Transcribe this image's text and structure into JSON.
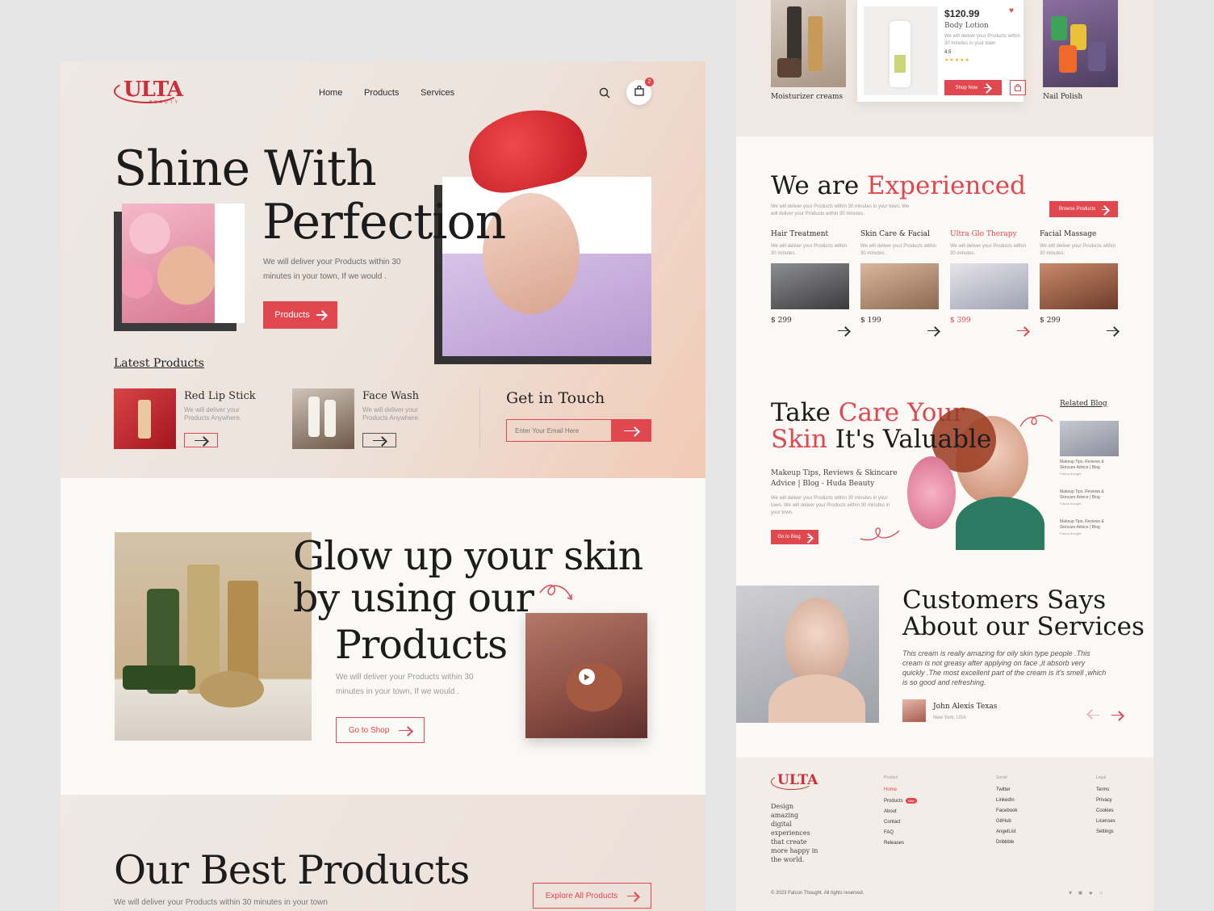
{
  "left": {
    "logo": "ULTA",
    "logo_sub": "BEAUTY",
    "nav": [
      "Home",
      "Products",
      "Services"
    ],
    "cart_count": "2",
    "hero": {
      "title_line1": "Shine With",
      "title_line2": "Perfection",
      "desc": "We will deliver your Products within 30 minutes in your town, If we would .",
      "cta": "Products"
    },
    "latest_title": "Latest Products",
    "latest": [
      {
        "name": "Red Lip Stick",
        "desc": "We will deliver your Products Anywhere."
      },
      {
        "name": "Face Wash",
        "desc": "We will deliver your Products Anywhere."
      }
    ],
    "contact": {
      "title": "Get in Touch",
      "placeholder": "Enter Your Email Here"
    },
    "glow": {
      "title_line1": "Glow up your skin",
      "title_line2": "by using our",
      "title_line3": "Products",
      "desc": "We will deliver your Products within 30 minutes in your town, If we would .",
      "cta": "Go to Shop"
    },
    "best": {
      "title": "Our Best Products",
      "desc": "We will deliver your Products within 30 minutes in your town",
      "cta": "Explore All Products"
    }
  },
  "right": {
    "products": [
      {
        "name": "Moisturizer creams"
      },
      {
        "name": "Nail Polish"
      }
    ],
    "featured": {
      "price": "$120.99",
      "name": "Body Lotion",
      "desc": "We will deliver your Products within 30 minutes in your town",
      "rating": "4.5",
      "stars": "★★★★★",
      "cta": "Shop Now"
    },
    "experienced": {
      "title_a": "We are ",
      "title_b": "Experienced",
      "desc": "We will deliver your Products within 30 minutes in your town. We will deliver your Products within 30 minutes.",
      "cta": "Browse Products"
    },
    "services": [
      {
        "name": "Hair Treatment",
        "desc": "We will deliver your Products within 30 minutes.",
        "price": "$ 299"
      },
      {
        "name": "Skin Care & Facial",
        "desc": "We will deliver your Products within 30 minutes.",
        "price": "$ 199"
      },
      {
        "name": "Ultra Glo Therapy",
        "desc": "We will deliver your Products within 30 minutes.",
        "price": "$ 399"
      },
      {
        "name": "Facial Massage",
        "desc": "We will deliver your Products within 30 minutes.",
        "price": "$ 299"
      }
    ],
    "care": {
      "title_a": "Take ",
      "title_b": "Care Your",
      "title_c": "Skin",
      "title_d": " It's Valuable",
      "subtitle": "Makeup Tips, Reviews & Skincare Advice | Blog - Huda Beauty",
      "desc": "We will deliver your Products within 30 minutes in your town. We will deliver your Products within 30 minutes in your town.",
      "cta": "Go to Blog"
    },
    "related": {
      "title": "Related Blog",
      "items": [
        {
          "text": "Makeup Tips, Reviews & Skincare Advice | Blog",
          "by": "Falcon thought"
        },
        {
          "text": "Makeup Tips, Reviews & Skincare Advice | Blog",
          "by": "Falcon thought"
        },
        {
          "text": "Makeup Tips, Reviews & Skincare Advice | Blog",
          "by": "Falcon thought"
        }
      ]
    },
    "testimonial": {
      "title_line1": "Customers Says",
      "title_line2": "About our Services",
      "quote": "This cream is really amazing for oily skin type people .This cream is not greasy after applying on face ,it absorb very quickly .The most excellent part of the cream is it's smell ,which is so good and refreshing.",
      "name": "John Alexis Texas",
      "location": "New York, USA"
    },
    "footer": {
      "logo": "ULTA",
      "tagline": "Design amazing digital experiences that create more happy in the world.",
      "cols": [
        {
          "title": "Product",
          "items": [
            "Home",
            "Products",
            "About",
            "Contact",
            "FAQ",
            "Releases"
          ]
        },
        {
          "title": "Social",
          "items": [
            "Twitter",
            "LinkedIn",
            "Facebook",
            "GitHub",
            "AngelList",
            "Dribbble"
          ]
        },
        {
          "title": "Legal",
          "items": [
            "Terms",
            "Privacy",
            "Cookies",
            "Licenses",
            "Settings"
          ]
        }
      ],
      "new_badge": "New",
      "copyright": "© 2023 Falcon Thought. All rights reserved."
    }
  },
  "colors": {
    "accent": "#e0474f",
    "bg": "#e6e6e6"
  }
}
